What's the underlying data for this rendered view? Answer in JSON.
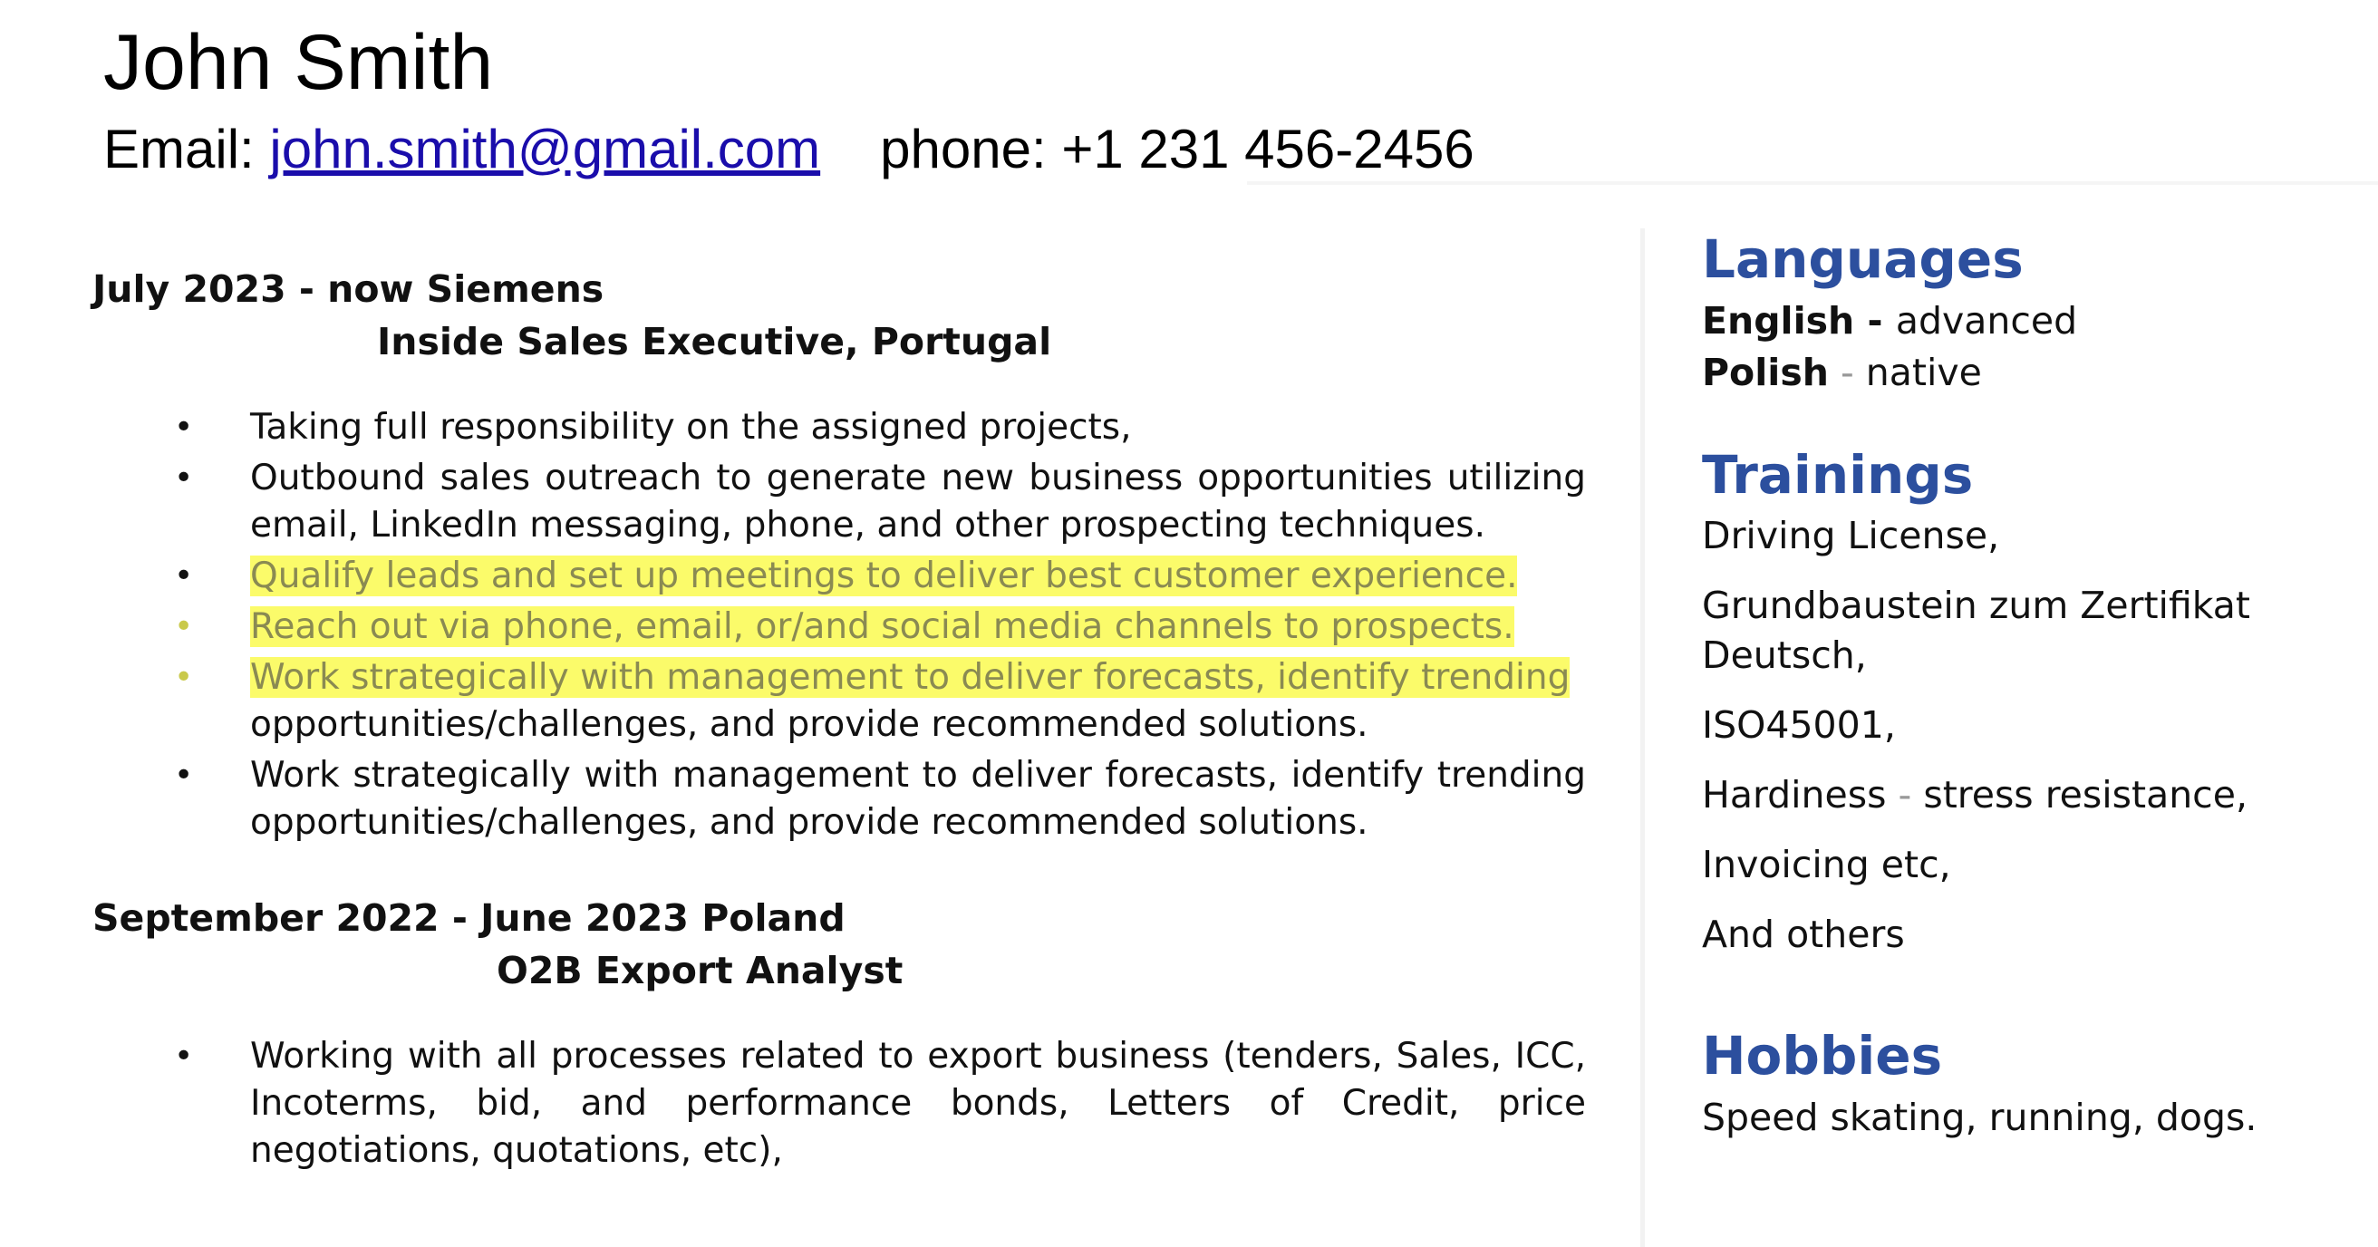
{
  "header": {
    "name": "John Smith",
    "email_label": "Email: ",
    "email": "john.smith@gmail.com",
    "phone": "phone: +1 231 456-2456"
  },
  "jobs": [
    {
      "period_company": "July 2023 - now Siemens",
      "title": "Inside Sales Executive, Portugal",
      "bullets": [
        "Taking full responsibility on the assigned projects,",
        "Outbound sales outreach to generate new business opportunities utilizing email, LinkedIn messaging, phone, and other prospecting techniques.",
        "Qualify leads and set up meetings to deliver best customer experience.",
        "Reach out via phone, email, or/and social media channels to prospects.",
        "Work strategically with management to deliver forecasts, identify trending",
        "opportunities/challenges, and provide recommended solutions.",
        "Work strategically with management to deliver forecasts, identify trending opportunities/challenges, and provide recommended solutions."
      ]
    },
    {
      "period_company": "September 2022 - June 2023 Poland",
      "title": "O2B Export Analyst",
      "bullets": [
        "Working with all processes related to export business (tenders, Sales, ICC, Incoterms, bid, and performance bonds, Letters of Credit, price negotiations, quotations, etc),"
      ]
    }
  ],
  "sidebar": {
    "languages_title": "Languages",
    "languages": [
      {
        "lang": "English",
        "sep": " - ",
        "level": "advanced"
      },
      {
        "lang": "Polish",
        "sep": " - ",
        "level": "native"
      }
    ],
    "trainings_title": "Trainings",
    "trainings": [
      "Driving License,",
      "Grundbaustein zum Zertifikat Deutsch,",
      "ISO45001,",
      "Hardiness",
      "stress resistance,",
      "Invoicing etc,",
      "And others"
    ],
    "hobbies_title": "Hobbies",
    "hobbies": "Speed skating, running, dogs."
  },
  "bullet_char": "•",
  "colors": {
    "section_heading": "#2c4f9e",
    "highlight": "#fbfb6a",
    "link": "#1a0dab"
  }
}
